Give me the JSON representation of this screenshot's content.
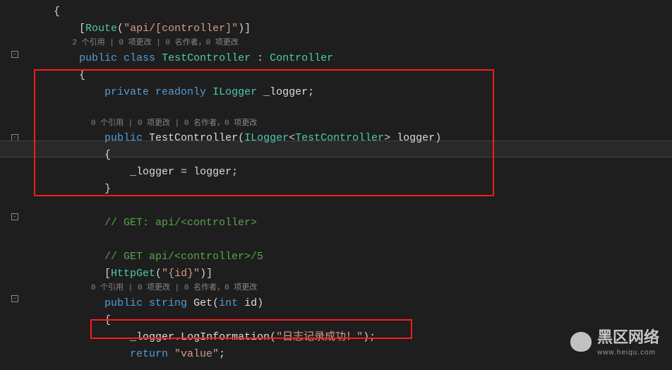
{
  "code": {
    "openBrace": "{",
    "routeAttr": {
      "open": "[",
      "route": "Route",
      "p1": "(",
      "s": "\"api/[controller]\"",
      "p2": ")",
      "close": "]"
    },
    "lens1": "2 个引用 | 0 项更改 | 0 名作者，0 项更改",
    "classDecl": {
      "public": "public",
      "class": "class",
      "name": "TestController",
      "colon": " : ",
      "base": "Controller"
    },
    "brace2": "{",
    "fieldDecl": {
      "private": "private",
      "readonly": "readonly",
      "type": "ILogger",
      "name": " _logger",
      "semi": ";"
    },
    "lens2": "0 个引用 | 0 项更改 | 0 名作者，0 项更改",
    "ctor": {
      "public": "public",
      "name": "TestController",
      "p1": "(",
      "type": "ILogger",
      "lt": "<",
      "gen": "TestController",
      "gt": ">",
      "param": " logger",
      "p2": ")"
    },
    "brace3": "{",
    "assign": {
      "lhs": "_logger",
      "eq": " = ",
      "rhs": "logger",
      "semi": ";"
    },
    "brace3c": "}",
    "comment1": "// GET: api/<controller>",
    "comment2": "// GET api/<controller>/5",
    "httpGet": {
      "open": "[",
      "name": "HttpGet",
      "p1": "(",
      "s": "\"{id}\"",
      "p2": ")",
      "close": "]"
    },
    "lens3": "0 个引用 | 0 项更改 | 0 名作者，0 项更改",
    "getDecl": {
      "public": "public",
      "ret": "string",
      "name": " Get",
      "p1": "(",
      "int": "int",
      "param": " id",
      "p2": ")"
    },
    "brace4": "{",
    "logCall": {
      "obj": "_logger",
      "dot": ".",
      "m": "LogInformation",
      "p1": "(",
      "s": "\"日志记录成功！\"",
      "p2": ")",
      "semi": ";"
    },
    "ret": {
      "return": "return",
      "val": " \"value\"",
      "semi": ";"
    }
  },
  "watermark": {
    "title": "黑区网络",
    "sub": "www.heiqu.com"
  }
}
